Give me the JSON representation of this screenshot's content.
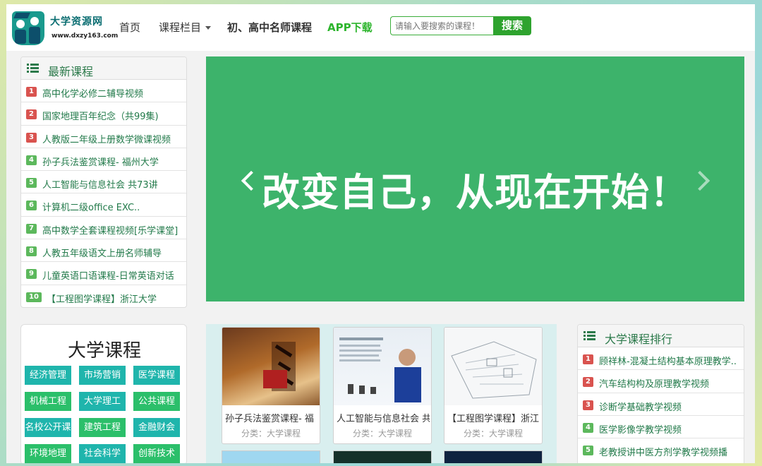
{
  "site": {
    "name": "大学资源网",
    "url": "www.dxzy163.com"
  },
  "nav": {
    "home": "首页",
    "columns": "课程栏目",
    "teachers": "初、高中名师课程",
    "app": "APP下载"
  },
  "search": {
    "placeholder": "请输入要搜索的课程！",
    "button": "搜索"
  },
  "latest": {
    "title": "最新课程",
    "items": [
      {
        "rank": "1",
        "text": "高中化学必修二辅导视频"
      },
      {
        "rank": "2",
        "text": "国家地理百年纪念（共99集)"
      },
      {
        "rank": "3",
        "text": "人教版二年级上册数学微课视频"
      },
      {
        "rank": "4",
        "text": "孙子兵法鉴赏课程- 福州大学"
      },
      {
        "rank": "5",
        "text": "人工智能与信息社会 共73讲"
      },
      {
        "rank": "6",
        "text": "计算机二级office EXC.."
      },
      {
        "rank": "7",
        "text": "高中数学全套课程视频[乐学课堂]"
      },
      {
        "rank": "8",
        "text": "人教五年级语文上册名师辅导"
      },
      {
        "rank": "9",
        "text": "儿童英语口语课程-日常英语对话"
      },
      {
        "rank": "10",
        "text": "【工程图学课程】浙江大学"
      }
    ]
  },
  "banner": {
    "slogan": "改变自己，从现在开始！",
    "active_slide": 1,
    "slide_count": 3
  },
  "university": {
    "title": "大学课程",
    "tags": [
      "经济管理",
      "市场营销",
      "医学课程",
      "机械工程",
      "大学理工",
      "公共课程",
      "名校公开课",
      "建筑工程",
      "金融财会",
      "环境地理",
      "社会科学",
      "创新技术"
    ]
  },
  "courses": [
    {
      "title": "孙子兵法鉴赏课程- 福",
      "category": "分类：大学课程"
    },
    {
      "title": "人工智能与信息社会 共",
      "category": "分类：大学课程"
    },
    {
      "title": "【工程图学课程】浙江",
      "category": "分类：大学课程"
    }
  ],
  "ranking": {
    "title": "大学课程排行",
    "items": [
      {
        "rank": "1",
        "text": "顾祥林-混凝土结构基本原理教学.."
      },
      {
        "rank": "2",
        "text": "汽车结构构及原理教学视频"
      },
      {
        "rank": "3",
        "text": "诊断学基础教学视频"
      },
      {
        "rank": "4",
        "text": "医学影像学教学视频"
      },
      {
        "rank": "5",
        "text": "老教授讲中医方剂学教学视频播"
      }
    ]
  },
  "colors": {
    "brand_green": "#3db36b",
    "link_green": "#227a4a",
    "badge_red": "#d9534f",
    "badge_green": "#5cb85c",
    "tag_teal": "#1fb5ac"
  }
}
